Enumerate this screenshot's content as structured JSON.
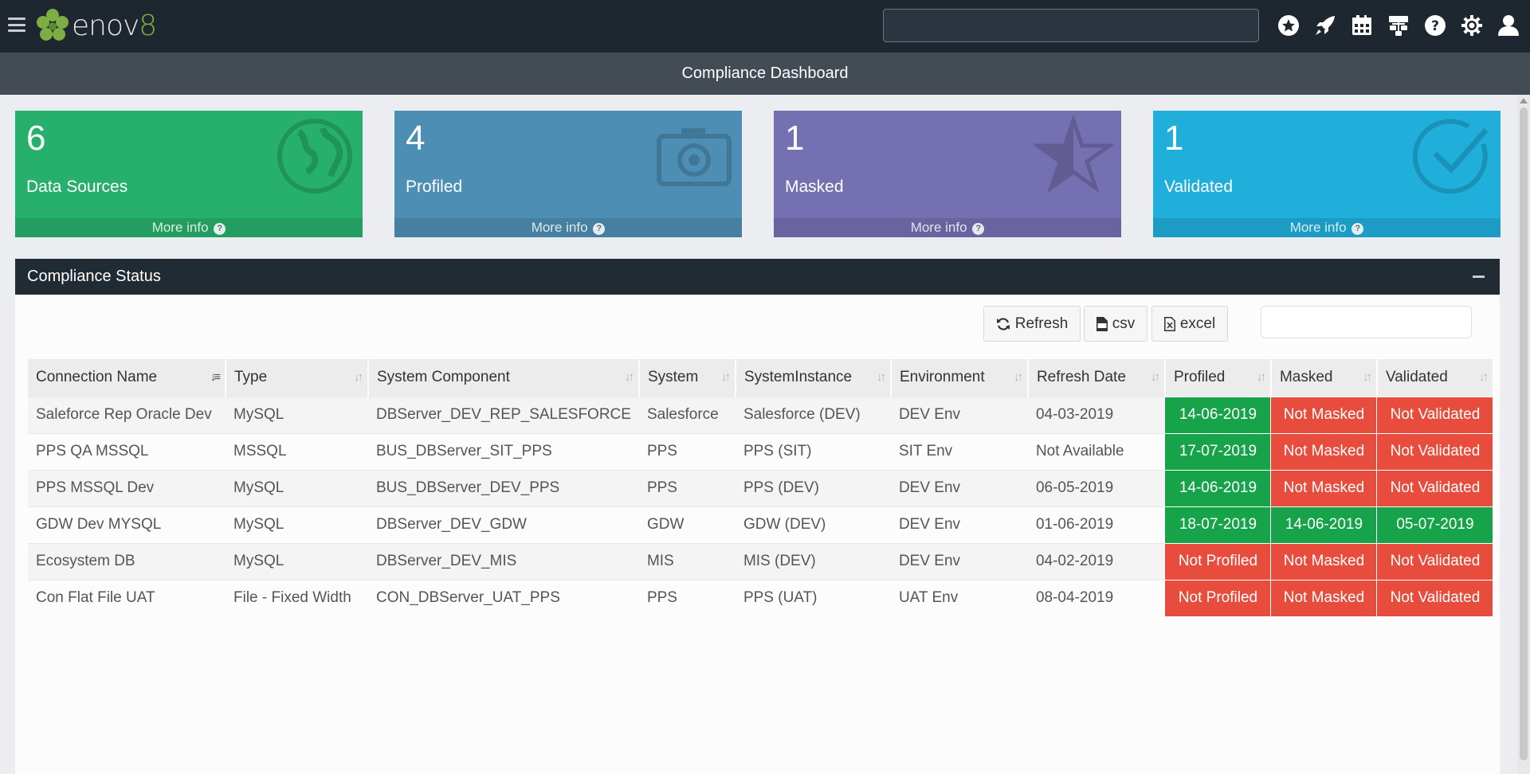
{
  "app": {
    "logo_main": "enov",
    "logo_suffix": "8"
  },
  "topbar": {
    "search_placeholder": "",
    "icons": [
      "star-icon",
      "rocket-icon",
      "calendar-icon",
      "org-chart-icon",
      "help-icon",
      "gear-icon",
      "user-icon"
    ]
  },
  "page_title": "Compliance Dashboard",
  "info_boxes": [
    {
      "value": "6",
      "label": "Data Sources",
      "more": "More info",
      "icon": "globe-icon",
      "color": "#27b06b"
    },
    {
      "value": "4",
      "label": "Profiled",
      "more": "More info",
      "icon": "camera-icon",
      "color": "#4d8fb4"
    },
    {
      "value": "1",
      "label": "Masked",
      "more": "More info",
      "icon": "star-half-icon",
      "color": "#7570b1"
    },
    {
      "value": "1",
      "label": "Validated",
      "more": "More info",
      "icon": "check-circle-icon",
      "color": "#20aedb"
    }
  ],
  "panel": {
    "title": "Compliance Status",
    "buttons": {
      "refresh": "Refresh",
      "csv": "csv",
      "excel": "excel"
    },
    "search_placeholder": ""
  },
  "table": {
    "columns": [
      "Connection Name",
      "Type",
      "System Component",
      "System",
      "SystemInstance",
      "Environment",
      "Refresh Date",
      "Profiled",
      "Masked",
      "Validated"
    ],
    "rows": [
      {
        "connection": "Saleforce Rep Oracle Dev",
        "type": "MySQL",
        "component": "DBServer_DEV_REP_SALESFORCE",
        "system": "Salesforce",
        "instance": "Salesforce (DEV)",
        "environment": "DEV Env",
        "refresh": "04-03-2019",
        "profiled": "14-06-2019",
        "profiled_ok": true,
        "masked": "Not Masked",
        "masked_ok": false,
        "validated": "Not Validated",
        "validated_ok": false
      },
      {
        "connection": "PPS QA MSSQL",
        "type": "MSSQL",
        "component": "BUS_DBServer_SIT_PPS",
        "system": "PPS",
        "instance": "PPS (SIT)",
        "environment": "SIT Env",
        "refresh": "Not Available",
        "profiled": "17-07-2019",
        "profiled_ok": true,
        "masked": "Not Masked",
        "masked_ok": false,
        "validated": "Not Validated",
        "validated_ok": false
      },
      {
        "connection": "PPS MSSQL Dev",
        "type": "MySQL",
        "component": "BUS_DBServer_DEV_PPS",
        "system": "PPS",
        "instance": "PPS (DEV)",
        "environment": "DEV Env",
        "refresh": "06-05-2019",
        "profiled": "14-06-2019",
        "profiled_ok": true,
        "masked": "Not Masked",
        "masked_ok": false,
        "validated": "Not Validated",
        "validated_ok": false
      },
      {
        "connection": "GDW Dev MYSQL",
        "type": "MySQL",
        "component": "DBServer_DEV_GDW",
        "system": "GDW",
        "instance": "GDW (DEV)",
        "environment": "DEV Env",
        "refresh": "01-06-2019",
        "profiled": "18-07-2019",
        "profiled_ok": true,
        "masked": "14-06-2019",
        "masked_ok": true,
        "validated": "05-07-2019",
        "validated_ok": true
      },
      {
        "connection": "Ecosystem DB",
        "type": "MySQL",
        "component": "DBServer_DEV_MIS",
        "system": "MIS",
        "instance": "MIS (DEV)",
        "environment": "DEV Env",
        "refresh": "04-02-2019",
        "profiled": "Not Profiled",
        "profiled_ok": false,
        "masked": "Not Masked",
        "masked_ok": false,
        "validated": "Not Validated",
        "validated_ok": false
      },
      {
        "connection": "Con Flat File UAT",
        "type": "File - Fixed Width",
        "component": "CON_DBServer_UAT_PPS",
        "system": "PPS",
        "instance": "PPS (UAT)",
        "environment": "UAT Env",
        "refresh": "08-04-2019",
        "profiled": "Not Profiled",
        "profiled_ok": false,
        "masked": "Not Masked",
        "masked_ok": false,
        "validated": "Not Validated",
        "validated_ok": false
      }
    ]
  }
}
